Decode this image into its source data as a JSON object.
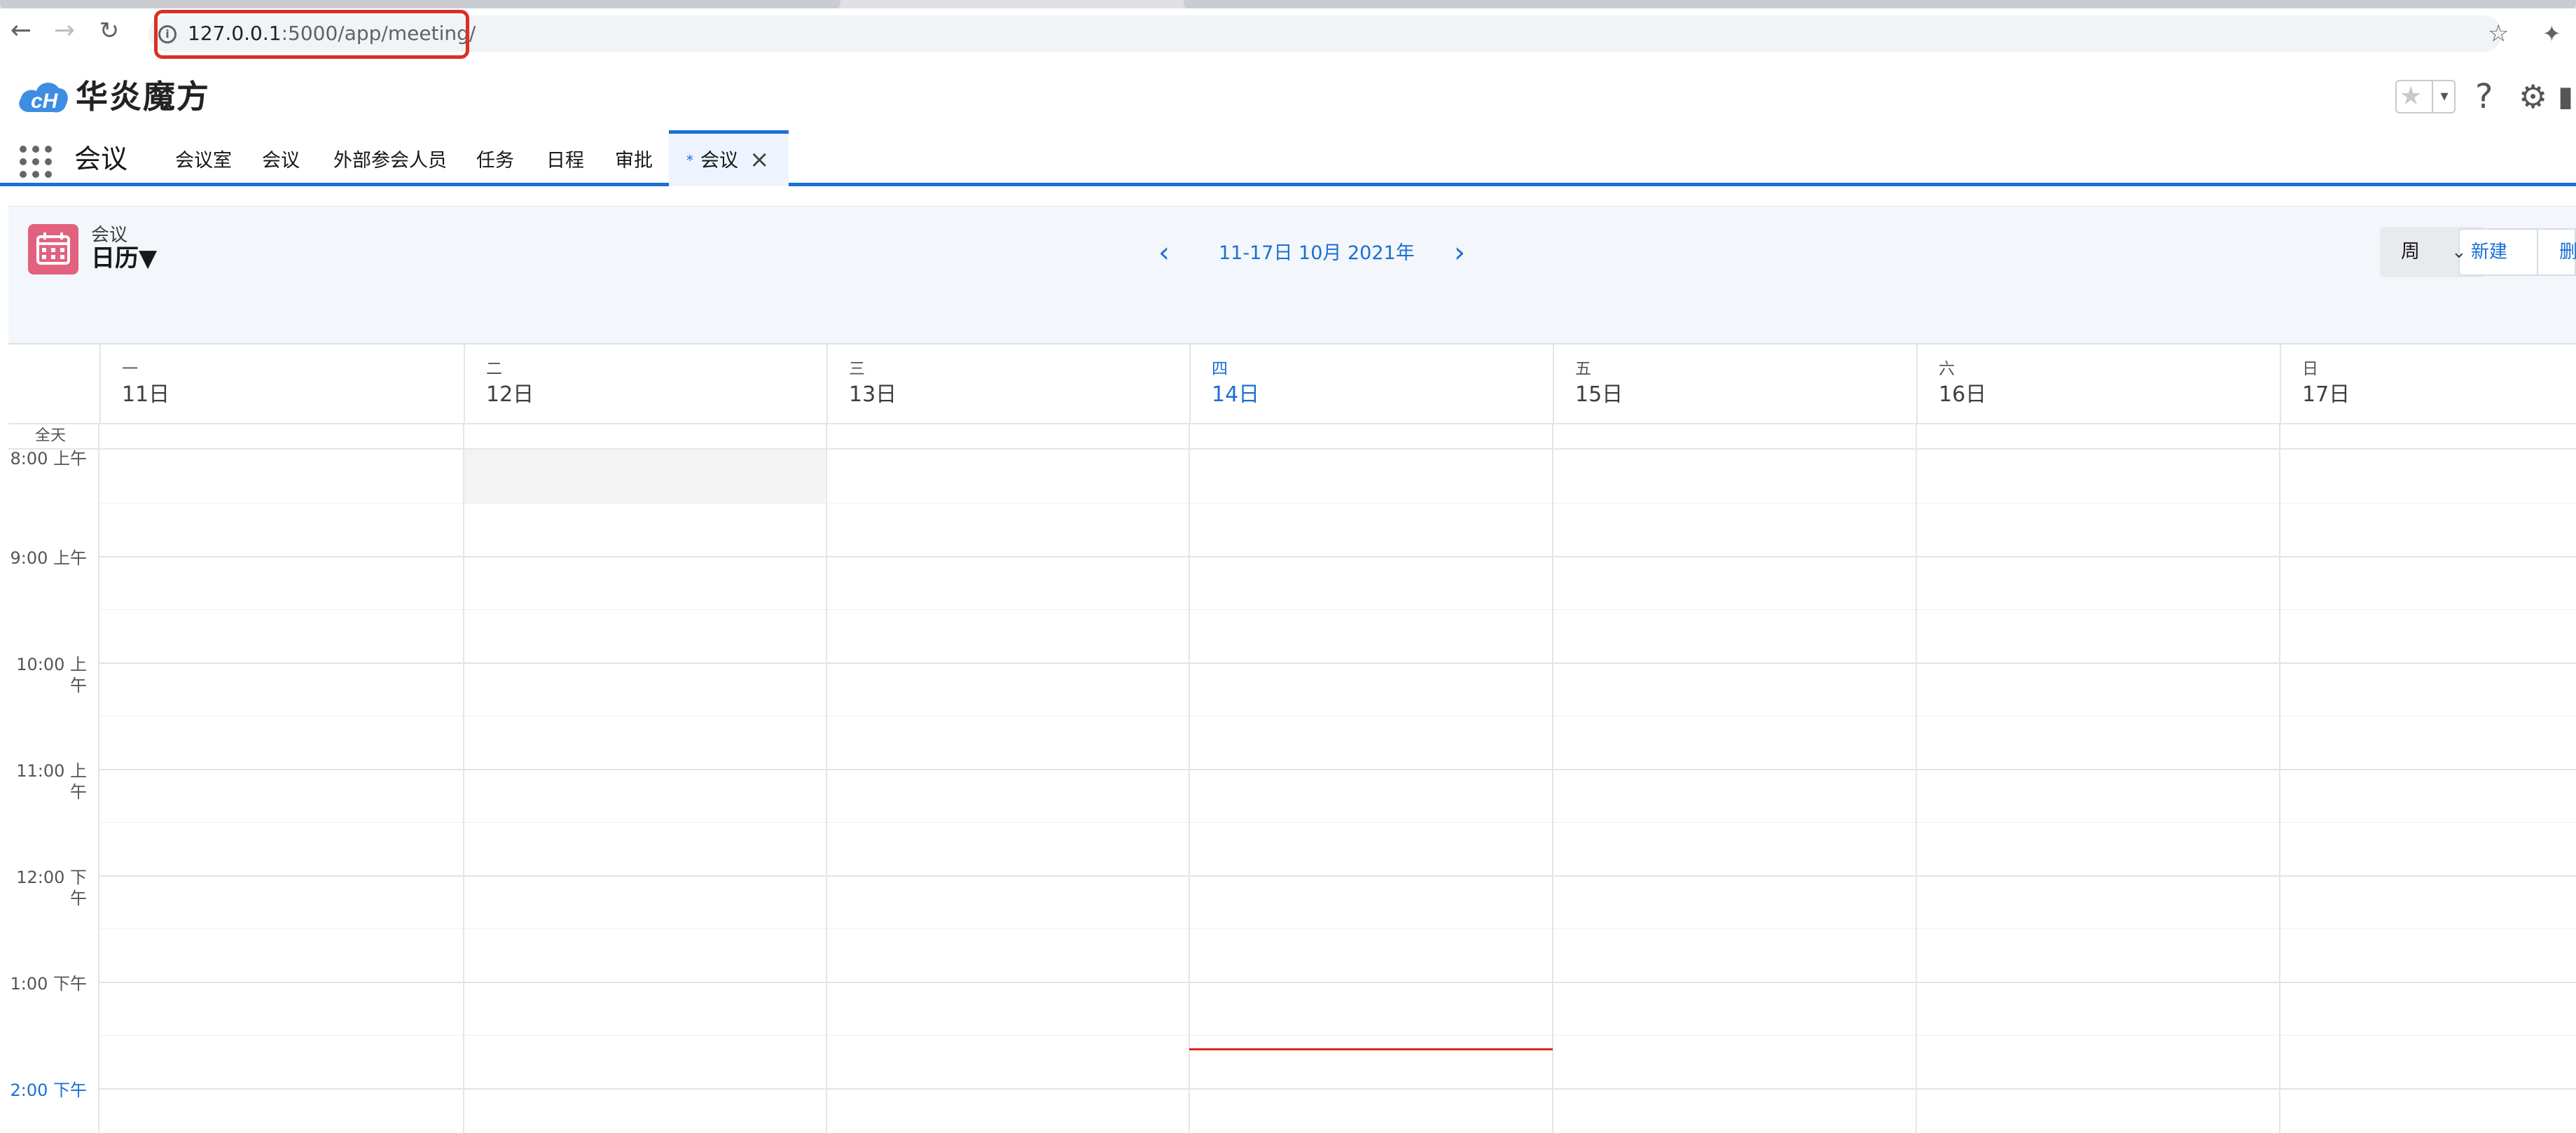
{
  "browser": {
    "url_host": "127.0.0.1",
    "url_rest": ":5000/app/meeting/",
    "back_icon": "arrow-left-icon",
    "forward_icon": "arrow-right-icon",
    "reload_icon": "reload-icon",
    "highlight_color": "#d93025"
  },
  "header": {
    "logo_text": "华炎魔方",
    "help_glyph": "?",
    "accent_color": "#1b6fd3"
  },
  "nav": {
    "app_name": "会议",
    "items": [
      "会议室",
      "会议",
      "外部参会人员",
      "任务",
      "日程",
      "审批"
    ],
    "active_tab": "会议"
  },
  "calendar_header": {
    "object_type": "会议",
    "view_name": "日历",
    "date_range": "11-17日 10月 2021年",
    "view_mode": "周",
    "new_button": "新建",
    "delete_button": "删除"
  },
  "calendar": {
    "days": [
      {
        "dow": "一",
        "date": "11日",
        "today": false
      },
      {
        "dow": "二",
        "date": "12日",
        "today": false
      },
      {
        "dow": "三",
        "date": "13日",
        "today": false
      },
      {
        "dow": "四",
        "date": "14日",
        "today": true
      },
      {
        "dow": "五",
        "date": "15日",
        "today": false
      },
      {
        "dow": "六",
        "date": "16日",
        "today": false
      },
      {
        "dow": "日",
        "date": "17日",
        "today": false
      }
    ],
    "all_day_label": "全天",
    "time_slots": [
      "8:00 上午",
      "9:00 上午",
      "10:00 上\n午",
      "11:00 上\n午",
      "12:00 下\n午",
      "1:00 下午",
      "2:00 下午"
    ],
    "current_time_slot": "2:00 下午"
  }
}
